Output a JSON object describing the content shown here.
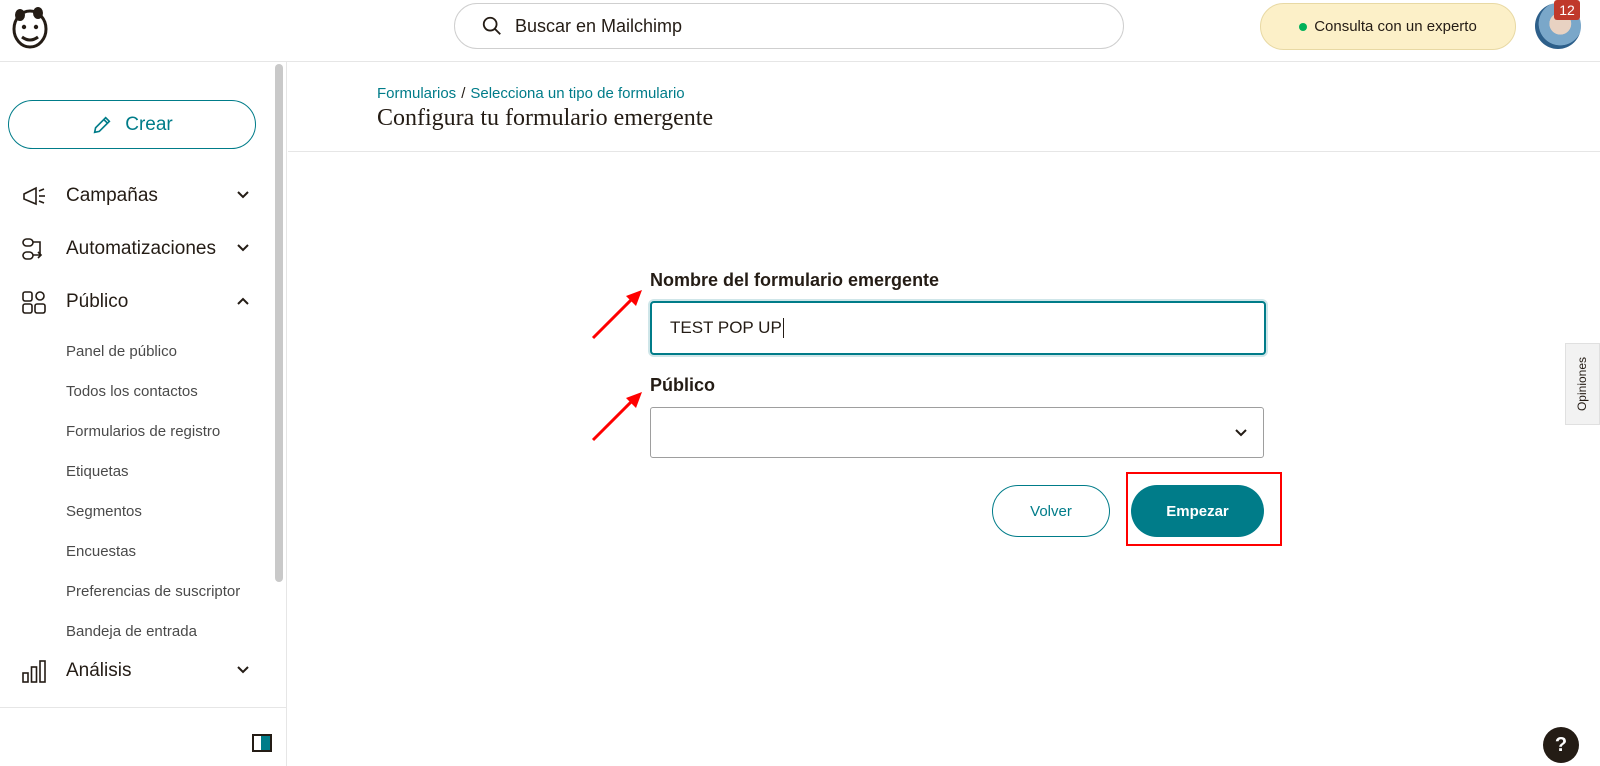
{
  "header": {
    "search_placeholder": "Buscar en Mailchimp",
    "expert_label": "Consulta con un experto",
    "notification_count": "12"
  },
  "sidebar": {
    "create_label": "Crear",
    "items": [
      {
        "label": "Campañas",
        "icon": "megaphone-icon",
        "expanded": false
      },
      {
        "label": "Automatizaciones",
        "icon": "automation-icon",
        "expanded": false
      },
      {
        "label": "Público",
        "icon": "audience-icon",
        "expanded": true
      },
      {
        "label": "Análisis",
        "icon": "bar-chart-icon",
        "expanded": false
      }
    ],
    "public_subitems": [
      "Panel de público",
      "Todos los contactos",
      "Formularios de registro",
      "Etiquetas",
      "Segmentos",
      "Encuestas",
      "Preferencias de suscriptor",
      "Bandeja de entrada"
    ]
  },
  "main": {
    "breadcrumb": [
      "Formularios",
      "Selecciona un tipo de formulario"
    ],
    "title": "Configura tu formulario emergente",
    "form": {
      "name_label": "Nombre del formulario emergente",
      "name_value": "TEST POP UP",
      "audience_label": "Público",
      "audience_value": ""
    },
    "back_label": "Volver",
    "start_label": "Empezar"
  },
  "feedback_label": "Opiniones",
  "help_label": "?",
  "colors": {
    "accent": "#007c89",
    "expert_bg": "#fcf0c8",
    "annotation": "#ff0000"
  }
}
